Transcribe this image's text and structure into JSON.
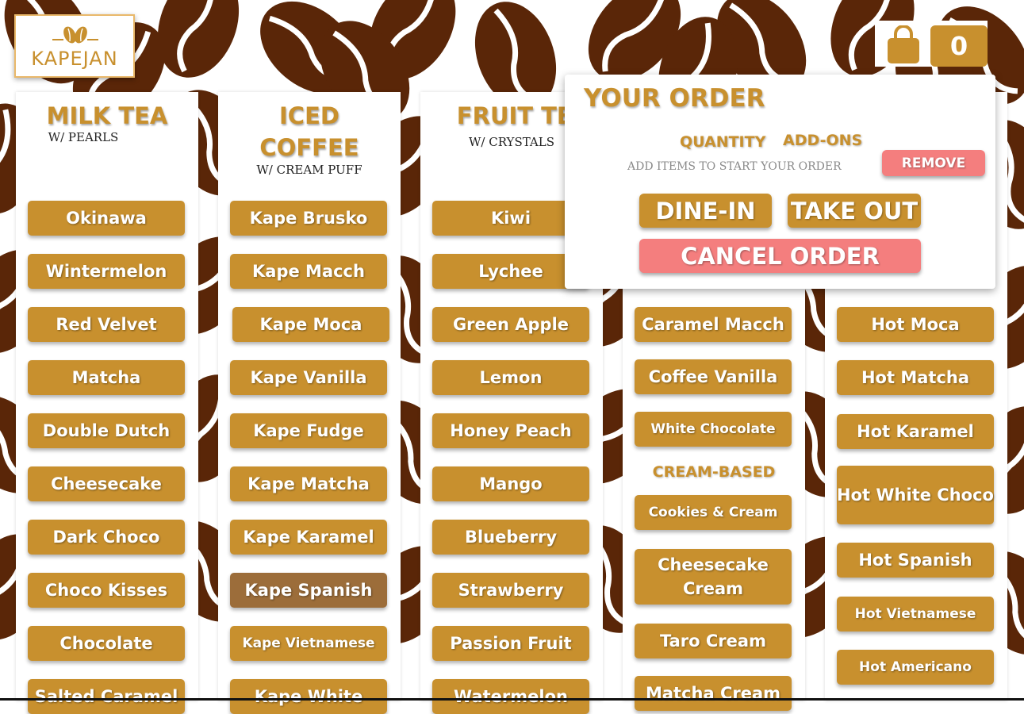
{
  "brand": {
    "name": "KAPEJAN",
    "logo_icon": "coffee-bean-logo-icon"
  },
  "colors": {
    "accent": "#c8902e",
    "danger": "#f47e7e",
    "bean": "#5a2608"
  },
  "cart": {
    "count": "0",
    "icon": "shopping-bag-icon"
  },
  "columns": [
    {
      "title": "MILK TEA",
      "subtitle": "W/ PEARLS",
      "items": [
        "Okinawa",
        "Wintermelon",
        "Red Velvet",
        "Matcha",
        "Double Dutch",
        "Cheesecake",
        "Dark Choco",
        "Choco Kisses",
        "Chocolate",
        "Salted Caramel"
      ]
    },
    {
      "title": "ICED COFFEE",
      "title_lines": [
        "ICED",
        "COFFEE"
      ],
      "subtitle": "W/ CREAM PUFF",
      "items": [
        "Kape Brusko",
        "Kape Macch",
        "Kape Moca",
        "Kape Vanilla",
        "Kape Fudge",
        "Kape Matcha",
        "Kape Karamel",
        "Kape Spanish",
        "Kape Vietnamese",
        "Kape White"
      ]
    },
    {
      "title": "FRUIT TEA",
      "subtitle": "W/ CRYSTALS",
      "items": [
        "Kiwi",
        "Lychee",
        "Green Apple",
        "Lemon",
        "Honey Peach",
        "Mango",
        "Blueberry",
        "Strawberry",
        "Passion Fruit",
        "Watermelon"
      ]
    },
    {
      "title": "",
      "items": [
        "Caramel Macch",
        "Coffee Vanilla",
        "White Chocolate"
      ],
      "section_label": "CREAM-BASED",
      "items2": [
        "Cookies & Cream",
        "Cheesecake Cream",
        "Taro Cream",
        "Matcha Cream"
      ]
    },
    {
      "title": "",
      "items": [
        "Hot Moca",
        "Hot Matcha",
        "Hot  Karamel",
        "Hot White Choco",
        "Hot Spanish",
        "Hot Vietnamese",
        "Hot Americano"
      ]
    }
  ],
  "order": {
    "title": "YOUR ORDER",
    "quantity_label": "QUANTITY",
    "addons_label": "ADD-ONS",
    "empty_message": "ADD ITEMS TO START YOUR ORDER",
    "remove_label": "REMOVE",
    "dine_in_label": "DINE-IN",
    "take_out_label": "TAKE OUT",
    "cancel_label": "CANCEL ORDER"
  }
}
